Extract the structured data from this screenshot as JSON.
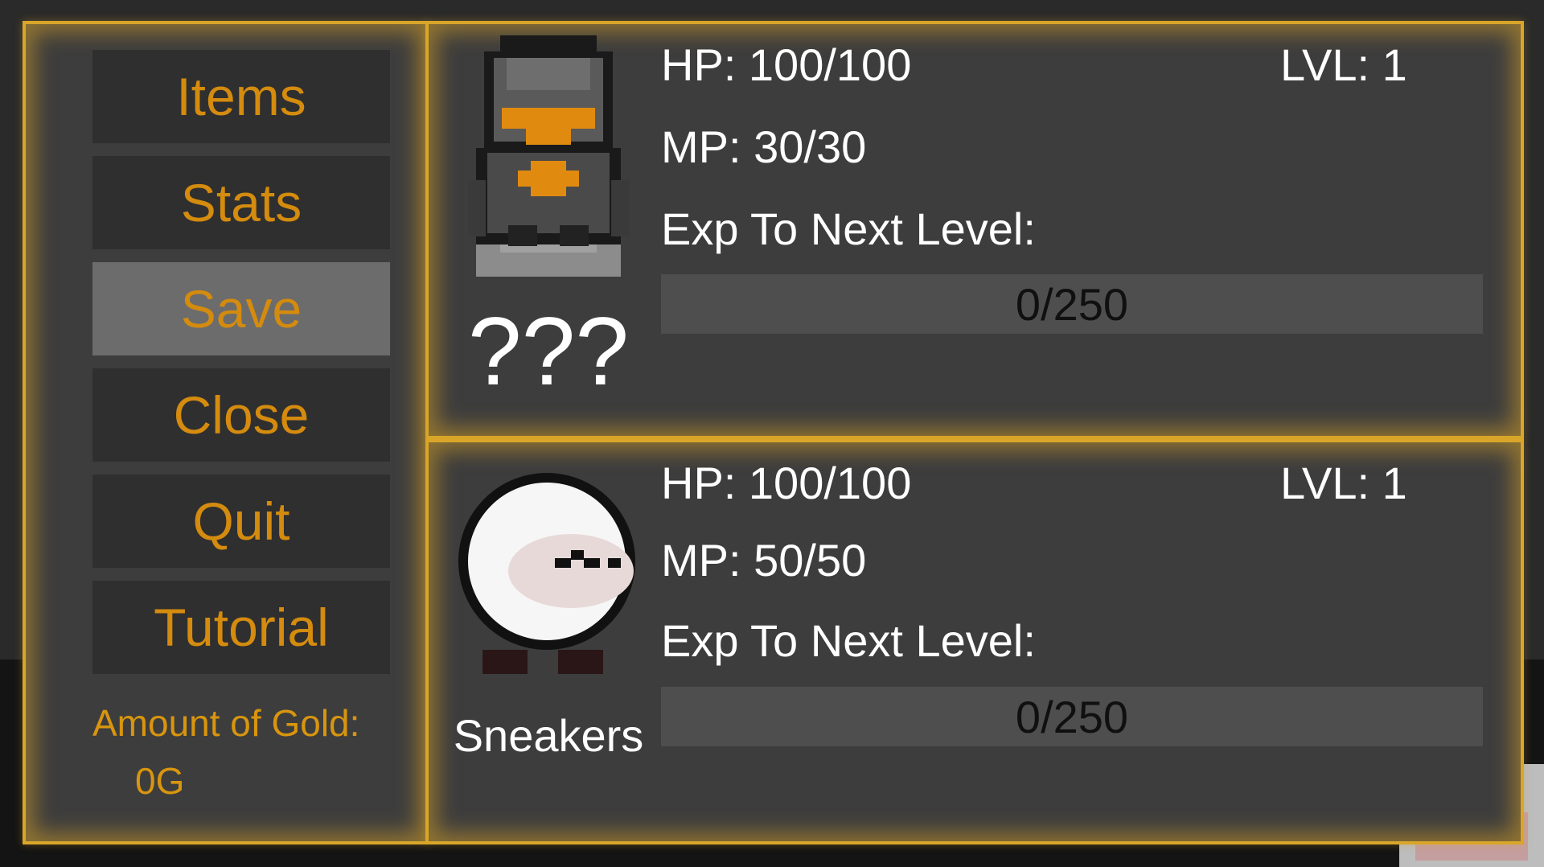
{
  "menu": {
    "items": [
      {
        "label": "Items"
      },
      {
        "label": "Stats"
      },
      {
        "label": "Save"
      },
      {
        "label": "Close"
      },
      {
        "label": "Quit"
      },
      {
        "label": "Tutorial"
      }
    ],
    "selected": "Save",
    "gold_label": "Amount of Gold:",
    "gold_value": "0G"
  },
  "party": [
    {
      "name": "???",
      "portrait_icon": "armored-knight-sprite-icon",
      "hp": "HP: 100/100",
      "mp": "MP: 30/30",
      "level": "LVL: 1",
      "exp_label": "Exp To Next Level:",
      "exp_text": "0/250",
      "exp_fraction": 0
    },
    {
      "name": "Sneakers",
      "portrait_icon": "white-ghost-sprite-icon",
      "hp": "HP: 100/100",
      "mp": "MP: 50/50",
      "level": "LVL: 1",
      "exp_label": "Exp To Next Level:",
      "exp_text": "0/250",
      "exp_fraction": 0
    }
  ],
  "colors": {
    "accent": "#d48b0e",
    "border": "#d9a62a",
    "panel": "#3d3d3d",
    "button": "#2f2f2f",
    "button_selected": "#6c6c6c"
  }
}
